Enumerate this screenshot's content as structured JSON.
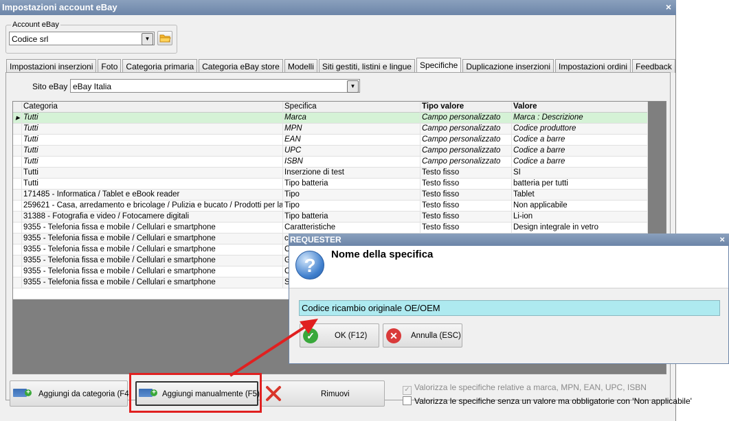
{
  "window": {
    "title": "Impostazioni account eBay",
    "close": "×"
  },
  "account": {
    "label": "Account eBay",
    "value": "Codice srl"
  },
  "tabs": [
    {
      "label": "Impostazioni inserzioni"
    },
    {
      "label": "Foto"
    },
    {
      "label": "Categoria primaria"
    },
    {
      "label": "Categoria eBay store"
    },
    {
      "label": "Modelli"
    },
    {
      "label": "Siti gestiti, listini e lingue"
    },
    {
      "label": "Specifiche"
    },
    {
      "label": "Duplicazione inserzioni"
    },
    {
      "label": "Impostazioni ordini"
    },
    {
      "label": "Feedback"
    }
  ],
  "active_tab": "Specifiche",
  "site": {
    "label": "Sito eBay :",
    "value": "eBay Italia"
  },
  "grid": {
    "headers": [
      "Categoria",
      "Specifica",
      "Tipo valore",
      "Valore"
    ],
    "rows": [
      [
        "Tutti",
        "Marca",
        "Campo personalizzato",
        "Marca : Descrizione"
      ],
      [
        "Tutti",
        "MPN",
        "Campo personalizzato",
        "Codice produttore"
      ],
      [
        "Tutti",
        "EAN",
        "Campo personalizzato",
        "Codice a barre"
      ],
      [
        "Tutti",
        "UPC",
        "Campo personalizzato",
        "Codice a barre"
      ],
      [
        "Tutti",
        "ISBN",
        "Campo personalizzato",
        "Codice a barre"
      ],
      [
        "Tutti",
        "Inserzione di test",
        "Testo fisso",
        "SI"
      ],
      [
        "Tutti",
        "Tipo batteria",
        "Testo fisso",
        "batteria per tutti"
      ],
      [
        "171485 - Informatica / Tablet e eBook reader",
        "Tipo",
        "Testo fisso",
        "Tablet"
      ],
      [
        "259621 - Casa, arredamento e bricolage / Pulizia e bucato / Prodotti per la ...",
        "Tipo",
        "Testo fisso",
        "Non applicabile"
      ],
      [
        "31388 - Fotografia e video / Fotocamere digitali",
        "Tipo batteria",
        "Testo fisso",
        "Li-ion"
      ],
      [
        "9355 - Telefonia fissa e mobile / Cellulari e smartphone",
        "Caratteristiche",
        "Testo fisso",
        "Design integrale in vetro"
      ],
      [
        "9355 - Telefonia fissa e mobile / Cellulari e smartphone",
        "c",
        "",
        ""
      ],
      [
        "9355 - Telefonia fissa e mobile / Cellulari e smartphone",
        "C",
        "",
        ""
      ],
      [
        "9355 - Telefonia fissa e mobile / Cellulari e smartphone",
        "G",
        "",
        ""
      ],
      [
        "9355 - Telefonia fissa e mobile / Cellulari e smartphone",
        "C",
        "",
        ""
      ],
      [
        "9355 - Telefonia fissa e mobile / Cellulari e smartphone",
        "S",
        "",
        ""
      ]
    ]
  },
  "buttons": {
    "add_category": "Aggiungi da categoria (F4)",
    "add_manual": "Aggiungi manualmente (F5)",
    "remove": "Rimuovi"
  },
  "checkboxes": {
    "brand_specs": {
      "label": "Valorizza le specifiche relative a marca, MPN, EAN, UPC, ISBN",
      "checked": true,
      "disabled": true
    },
    "not_applicable": {
      "label": "Valorizza le specifiche senza un valore ma obbligatorie con 'Non applicabile'",
      "checked": false
    }
  },
  "dialog": {
    "title": "REQUESTER",
    "close": "×",
    "heading": "Nome della specifica",
    "input_value": "Codice ricambio originale OE/OEM",
    "ok": "OK (F12)",
    "cancel": "Annulla (ESC)"
  },
  "colors": {
    "highlight": "#e02020",
    "selected_row": "#d5f2d6",
    "input_bg": "#aeeaf0",
    "title_bar": "#6c85a8"
  }
}
